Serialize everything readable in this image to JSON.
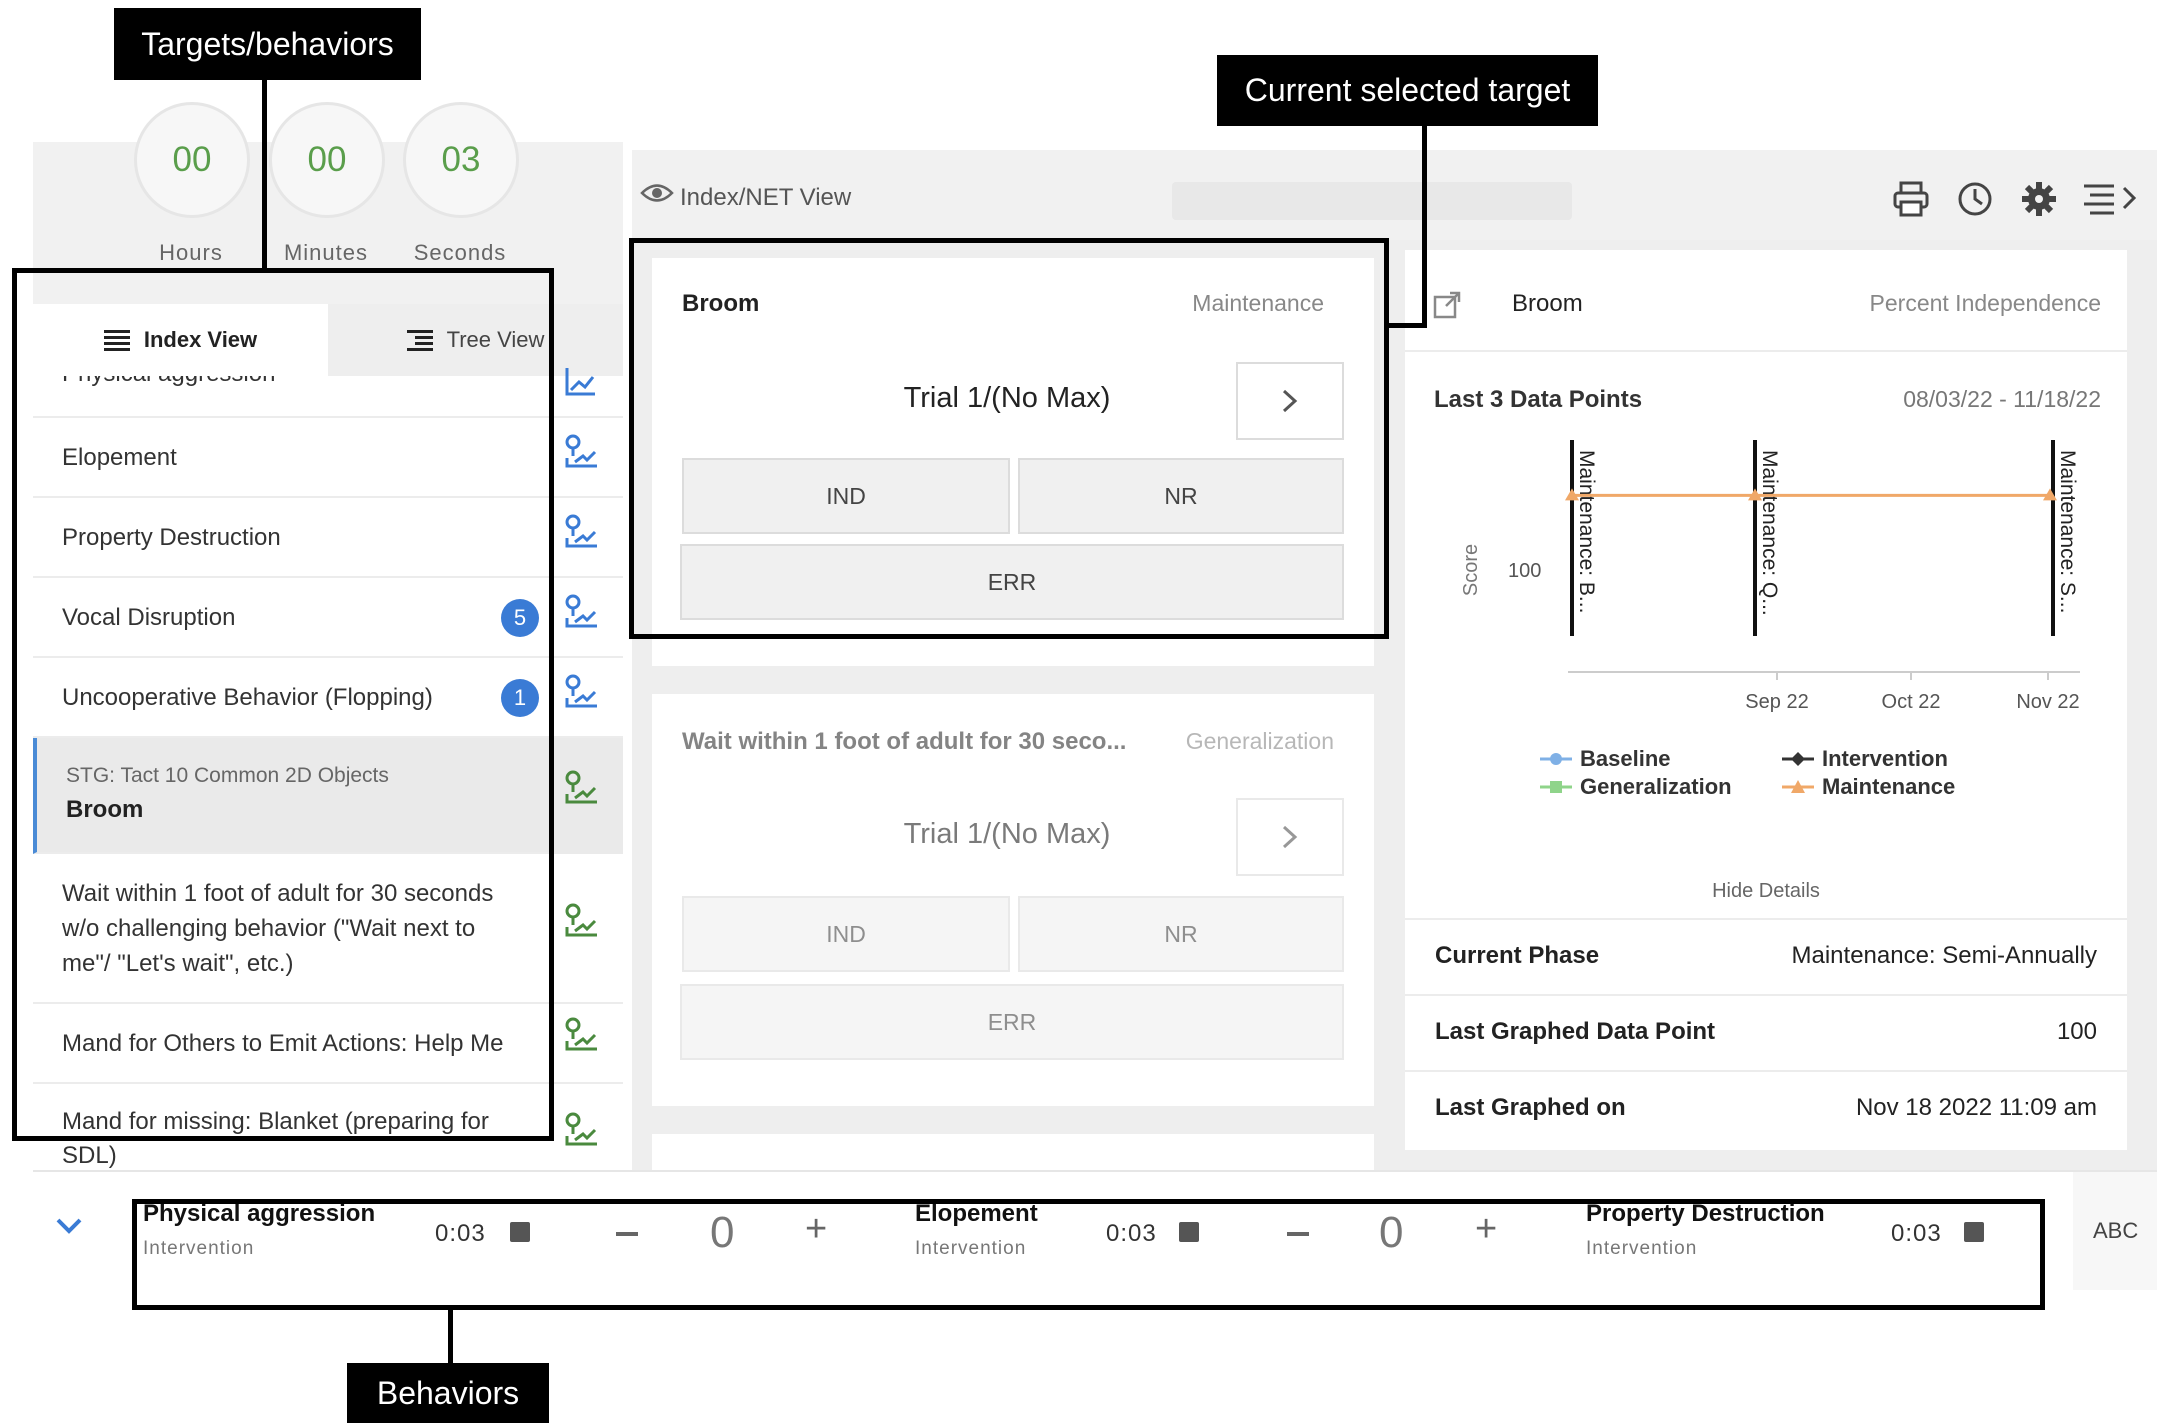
{
  "annotations": {
    "targets": "Targets/behaviors",
    "current": "Current selected target",
    "behaviors": "Behaviors"
  },
  "timer": {
    "hours": "00",
    "hours_label": "Hours",
    "minutes": "00",
    "minutes_label": "Minutes",
    "seconds": "03",
    "seconds_label": "Seconds"
  },
  "tabs": {
    "index": "Index View",
    "tree": "Tree View"
  },
  "list": {
    "partial_top": "Physical aggression",
    "items": [
      {
        "label": "Elopement"
      },
      {
        "label": "Property Destruction"
      },
      {
        "label": "Vocal Disruption",
        "badge": "5"
      },
      {
        "label": "Uncooperative Behavior (Flopping)",
        "badge": "1"
      }
    ],
    "selected": {
      "sub": "STG: Tact 10 Common 2D Objects",
      "label": "Broom"
    },
    "wait_lines": [
      "Wait within 1 foot of adult for 30 seconds",
      "w/o challenging behavior (\"Wait next to",
      "me\"/ \"Let's wait\", etc.)"
    ],
    "mand_help": "Mand for Others to Emit Actions: Help Me",
    "mand_blanket_lines": [
      "Mand for missing: Blanket (preparing for",
      "SDL)"
    ]
  },
  "header": {
    "view_title": "Index/NET View"
  },
  "card1": {
    "title": "Broom",
    "phase": "Maintenance",
    "trial": "Trial 1/(No Max)",
    "btn_ind": "IND",
    "btn_nr": "NR",
    "btn_err": "ERR"
  },
  "card2": {
    "title": "Wait within 1 foot of adult for 30 seco...",
    "phase": "Generalization",
    "trial": "Trial 1/(No Max)",
    "btn_ind": "IND",
    "btn_nr": "NR",
    "btn_err": "ERR"
  },
  "detail": {
    "title": "Broom",
    "metric": "Percent Independence",
    "last3": "Last 3 Data Points",
    "date_range": "08/03/22 - 11/18/22",
    "hide": "Hide Details",
    "rows": [
      {
        "label": "Current Phase",
        "value": "Maintenance: Semi-Annually"
      },
      {
        "label": "Last Graphed Data Point",
        "value": "100"
      },
      {
        "label": "Last Graphed on",
        "value": "Nov 18 2022 11:09 am"
      }
    ]
  },
  "chart_data": {
    "type": "line",
    "ylabel": "Score",
    "y_ticks": [
      "100"
    ],
    "x_ticks": [
      "Sep 22",
      "Oct 22",
      "Nov 22"
    ],
    "phase_lines": [
      "Maintenance: B...",
      "Maintenance: Q...",
      "Maintenance: S..."
    ],
    "legend": [
      "Baseline",
      "Intervention",
      "Generalization",
      "Maintenance"
    ],
    "series": [
      {
        "name": "Maintenance",
        "x": [
          "08/03/22",
          "09/23/22",
          "11/18/22"
        ],
        "values": [
          100,
          100,
          100
        ]
      }
    ],
    "colors": {
      "Baseline": "#7fb0e6",
      "Intervention": "#333333",
      "Generalization": "#8fd48a",
      "Maintenance": "#f0a868"
    }
  },
  "behaviors": [
    {
      "name": "Physical aggression",
      "phase": "Intervention",
      "time": "0:03",
      "count": "0"
    },
    {
      "name": "Elopement",
      "phase": "Intervention",
      "time": "0:03",
      "count": "0"
    },
    {
      "name": "Property Destruction",
      "phase": "Intervention",
      "time": "0:03"
    }
  ],
  "abc": "ABC",
  "colors": {
    "green": "#5a9e4b",
    "blue": "#3a7bd5"
  }
}
